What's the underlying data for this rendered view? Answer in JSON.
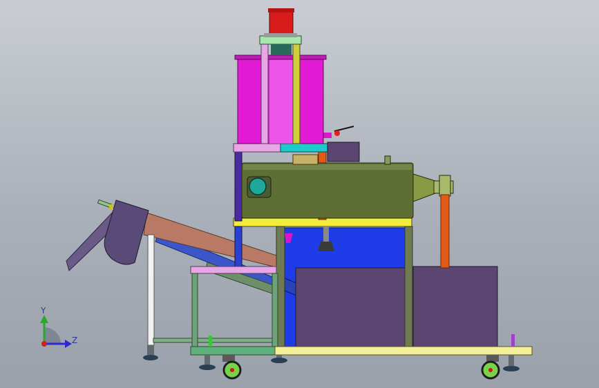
{
  "viewport": {
    "background_top": "#c9cdd3",
    "background_bottom": "#9aa1ab"
  },
  "triad": {
    "y_axis_label": "Y",
    "z_axis_label": "Z",
    "y_color": "#2aa82a",
    "z_color": "#2a2ad0",
    "origin_color": "#d02020"
  },
  "colors": {
    "motor": "#d81c1c",
    "tank": "#e21ad6",
    "drum": "#5e6e34",
    "frame_yellow": "#f2ec3a",
    "frame_pink": "#e7a6e6",
    "frame_cyan": "#1ecbcb",
    "frame_green": "#6ea27a",
    "pipe_orange": "#e25a16",
    "conveyor_belt": "#b87a64",
    "hopper": "#5a4a78",
    "water_tank": "#1e3ce8",
    "collection_box": "#5a4670",
    "wheel_green": "#7ad24a",
    "base_plate": "#f4f09a"
  }
}
